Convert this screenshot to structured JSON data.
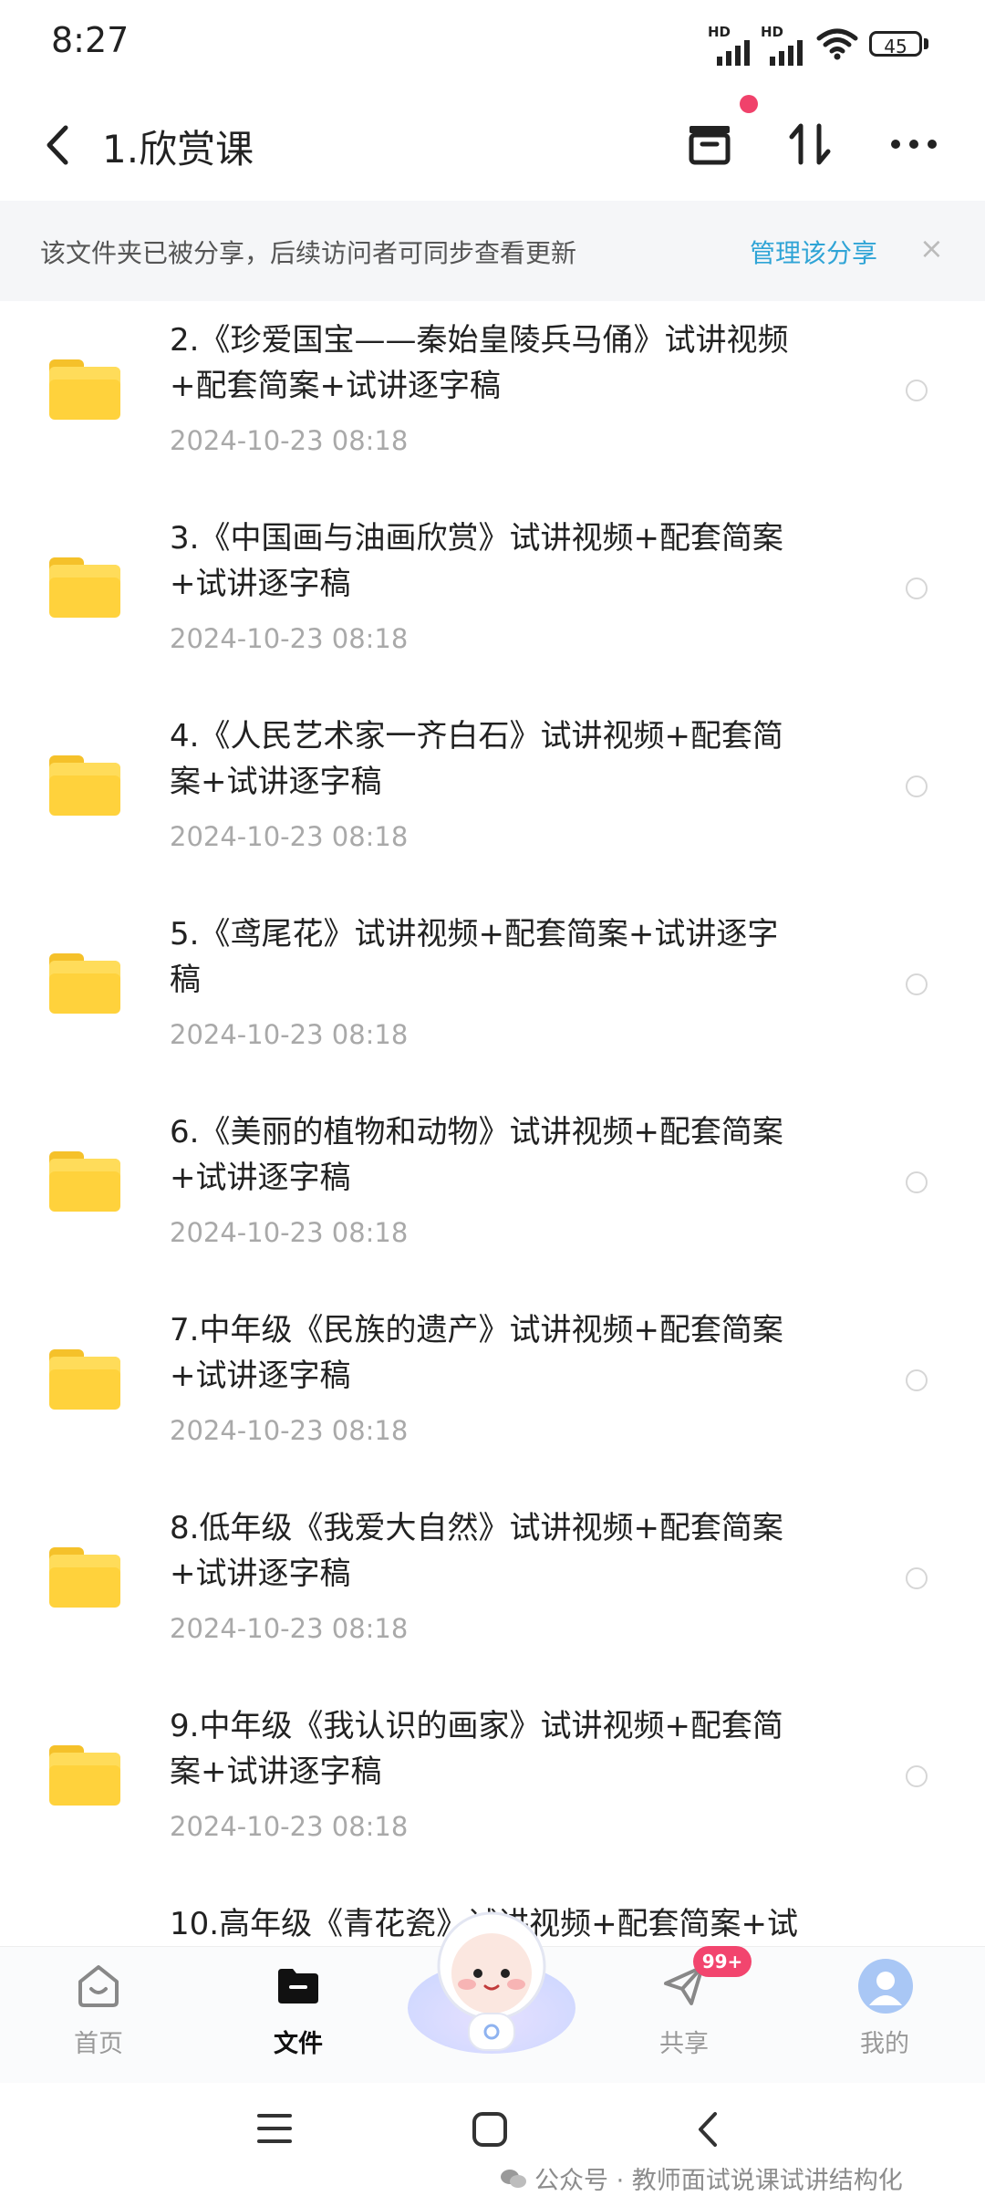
{
  "status_bar": {
    "time": "8:27",
    "signal_1_label": "HD",
    "signal_2_label": "HD",
    "battery": "45"
  },
  "header": {
    "title": "1.欣赏课"
  },
  "banner": {
    "text": "该文件夹已被分享，后续访问者可同步查看更新",
    "link": "管理该分享",
    "close": "×"
  },
  "files": [
    {
      "title_line1": "2.《珍爱国宝——秦始皇陵兵马俑》试讲视频",
      "title_line2": "+配套简案+试讲逐字稿",
      "date": "2024-10-23  08:18"
    },
    {
      "title_line1": "3.《中国画与油画欣赏》试讲视频+配套简案",
      "title_line2": "+试讲逐字稿",
      "date": "2024-10-23  08:18"
    },
    {
      "title_line1": "4.《人民艺术家一齐白石》试讲视频+配套简",
      "title_line2": "案+试讲逐字稿",
      "date": "2024-10-23  08:18"
    },
    {
      "title_line1": "5.《鸢尾花》试讲视频+配套简案+试讲逐字",
      "title_line2": "稿",
      "date": "2024-10-23  08:18"
    },
    {
      "title_line1": "6.《美丽的植物和动物》试讲视频+配套简案",
      "title_line2": "+试讲逐字稿",
      "date": "2024-10-23  08:18"
    },
    {
      "title_line1": "7.中年级《民族的遗产》试讲视频+配套简案",
      "title_line2": "+试讲逐字稿",
      "date": "2024-10-23  08:18"
    },
    {
      "title_line1": "8.低年级《我爱大自然》试讲视频+配套简案",
      "title_line2": "+试讲逐字稿",
      "date": "2024-10-23  08:18"
    },
    {
      "title_line1": "9.中年级《我认识的画家》试讲视频+配套简",
      "title_line2": "案+试讲逐字稿",
      "date": "2024-10-23  08:18"
    },
    {
      "title_line1": "10.高年级《青花瓷》试讲视频+配套简案+试",
      "title_line2": "",
      "date": ""
    }
  ],
  "tabbar": {
    "home": "首页",
    "files": "文件",
    "share": "共享",
    "share_badge": "99+",
    "mine": "我的"
  },
  "watermark": "公众号 · 教师面试说课试讲结构化",
  "colors": {
    "accent": "#2fa4d6",
    "folder": "#ffd23c",
    "badge": "#f2456e"
  }
}
